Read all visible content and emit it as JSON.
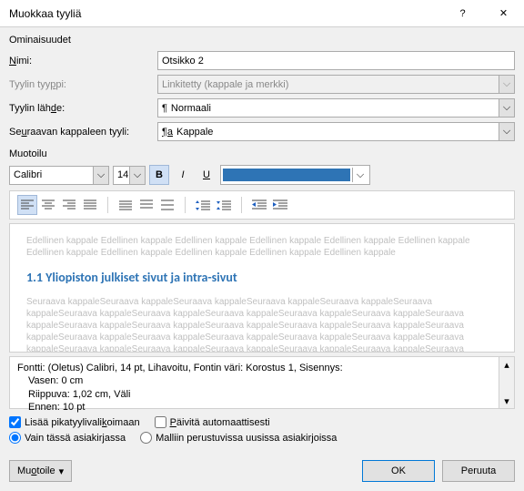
{
  "title": "Muokkaa tyyliä",
  "section_properties": "Ominaisuudet",
  "labels": {
    "name": "Nimi:",
    "style_type": "Tyylin tyyppi:",
    "style_based_on": "Tyylin lähde:",
    "next_paragraph": "Seuraavan kappaleen tyyli:"
  },
  "values": {
    "name": "Otsikko 2",
    "style_type": "Linkitetty (kappale ja merkki)",
    "style_based_on": "Normaali",
    "next_paragraph": "Kappale"
  },
  "section_format": "Muotoilu",
  "font": {
    "name": "Calibri",
    "size": "14",
    "color": "#2e74b5"
  },
  "preview": {
    "ghost_prev": "Edellinen kappale Edellinen kappale Edellinen kappale Edellinen kappale Edellinen kappale Edellinen kappale Edellinen kappale Edellinen kappale Edellinen kappale Edellinen kappale Edellinen kappale",
    "sample": "1.1  Yliopiston julkiset sivut ja intra-sivut",
    "ghost_next": "Seuraava kappaleSeuraava kappaleSeuraava kappaleSeuraava kappaleSeuraava kappaleSeuraava kappaleSeuraava kappaleSeuraava kappaleSeuraava kappaleSeuraava kappaleSeuraava kappaleSeuraava kappaleSeuraava kappaleSeuraava kappaleSeuraava kappaleSeuraava kappaleSeuraava kappaleSeuraava kappaleSeuraava kappaleSeuraava kappaleSeuraava kappaleSeuraava kappaleSeuraava kappaleSeuraava kappaleSeuraava kappaleSeuraava kappaleSeuraava kappaleSeuraava kappaleSeuraava kappaleSeuraava kappaleSeuraava kappale"
  },
  "description": {
    "line1": "Fontti: (Oletus) Calibri, 14 pt, Lihavoitu, Fontin väri: Korostus 1, Sisennys:",
    "line2": "Vasen:  0 cm",
    "line3": "Riippuva:  1,02 cm, Väli",
    "line4": "Ennen:  10 pt"
  },
  "checks": {
    "add_to_gallery": "Lisää pikatyylivalikoimaan",
    "auto_update": "Päivitä automaattisesti"
  },
  "radios": {
    "this_doc": "Vain tässä asiakirjassa",
    "template": "Malliin perustuvissa uusissa asiakirjoissa"
  },
  "buttons": {
    "format": "Muotoile",
    "ok": "OK",
    "cancel": "Peruuta"
  },
  "glyphs": {
    "help": "?",
    "close": "✕",
    "caret": "⌵",
    "pilcrow": "¶",
    "pilcrow_a": "¶a",
    "bold": "B",
    "italic": "I",
    "underline": "U",
    "tri_up": "▴",
    "tri_down": "▾",
    "tri_small": "▾"
  }
}
